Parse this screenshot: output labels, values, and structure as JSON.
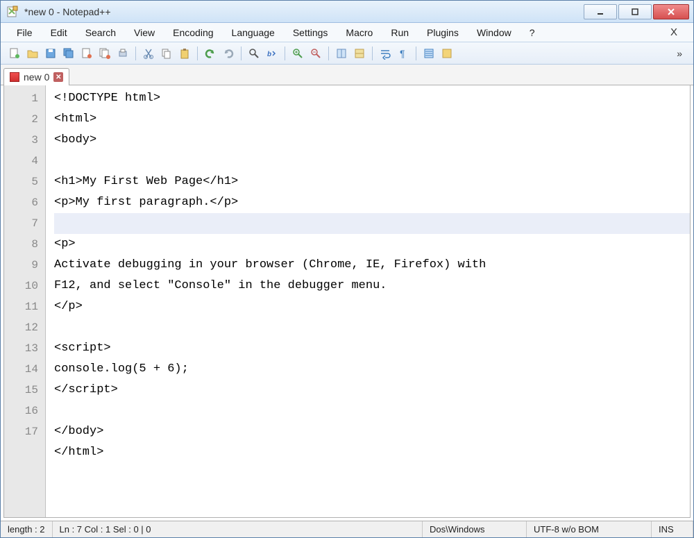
{
  "window": {
    "title": "*new  0 - Notepad++"
  },
  "menu": {
    "items": [
      "File",
      "Edit",
      "Search",
      "View",
      "Encoding",
      "Language",
      "Settings",
      "Macro",
      "Run",
      "Plugins",
      "Window",
      "?"
    ],
    "close_doc": "X"
  },
  "toolbar": {
    "icons": [
      "new-file-icon",
      "open-file-icon",
      "save-icon",
      "save-all-icon",
      "close-icon",
      "close-all-icon",
      "print-icon",
      "sep",
      "cut-icon",
      "copy-icon",
      "paste-icon",
      "sep",
      "undo-icon",
      "redo-icon",
      "sep",
      "find-icon",
      "replace-icon",
      "sep",
      "zoom-in-icon",
      "zoom-out-icon",
      "sep",
      "sync-v-icon",
      "sync-h-icon",
      "sep",
      "wordwrap-icon",
      "show-chars-icon",
      "sep",
      "indent-guide-icon",
      "udl-icon"
    ],
    "more": "»"
  },
  "tab": {
    "label": "new  0"
  },
  "editor": {
    "line_numbers": [
      "1",
      "2",
      "3",
      "4",
      "5",
      "6",
      "7",
      "8",
      "9",
      "",
      "10",
      "11",
      "12",
      "13",
      "14",
      "15",
      "16",
      "17"
    ],
    "lines": [
      "<!DOCTYPE html>",
      "<html>",
      "<body>",
      "",
      "<h1>My First Web Page</h1>",
      "<p>My first paragraph.</p>",
      "",
      "<p>",
      "Activate debugging in your browser (Chrome, IE, Firefox) with",
      "F12, and select \"Console\" in the debugger menu.",
      "</p>",
      "",
      "<script>",
      "console.log(5 + 6);",
      "</script>",
      "",
      "</body>",
      "</html>"
    ],
    "current_line_index": 6
  },
  "status": {
    "length": "length : 2",
    "pos": "Ln : 7    Col : 1    Sel : 0 | 0",
    "eol": "Dos\\Windows",
    "encoding": "UTF-8 w/o BOM",
    "mode": "INS"
  }
}
